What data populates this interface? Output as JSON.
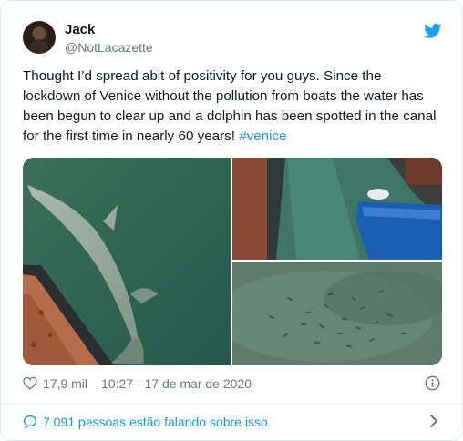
{
  "author": {
    "name": "Jack",
    "handle": "@NotLacazette"
  },
  "tweet": {
    "text": "Thought I’d spread abit of positivity for you guys. Since the lockdown of Venice without the pollution from boats the water has been begun to clear up and a dolphin has been spotted in the canal for the first time in nearly 60 years! ",
    "hashtag": "#venice"
  },
  "media": {
    "images": [
      "dolphin-in-canal",
      "canal-with-boat",
      "fish-in-clear-water"
    ]
  },
  "meta": {
    "likes": "17,9 mil",
    "timestamp": "10:27 - 17 de mar de 2020"
  },
  "conversation": {
    "label": "7.091 pessoas estão falando sobre isso"
  },
  "icons": {
    "brand": "twitter-bird-icon",
    "like": "heart-icon",
    "info": "info-icon",
    "reply": "chat-bubble-icon",
    "more": "chevron-right-icon"
  },
  "colors": {
    "accent": "#1da1f2",
    "link": "#1b95e0",
    "muted": "#657786",
    "text": "#14171a"
  }
}
